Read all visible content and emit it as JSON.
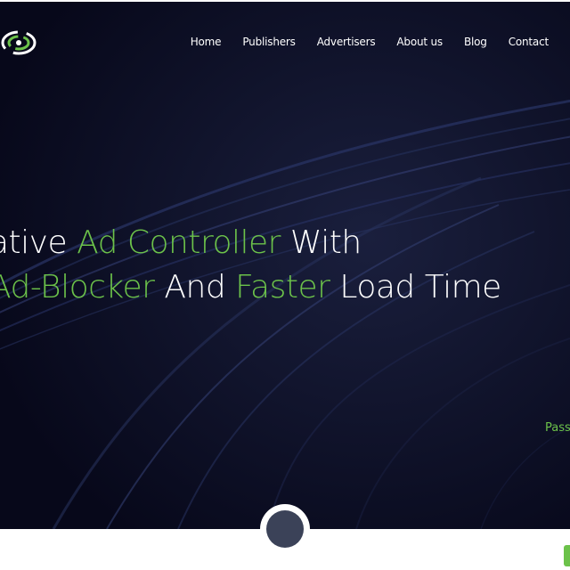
{
  "nav": {
    "items": [
      {
        "label": "Home"
      },
      {
        "label": "Publishers"
      },
      {
        "label": "Advertisers"
      },
      {
        "label": "About us"
      },
      {
        "label": "Blog"
      },
      {
        "label": "Contact"
      }
    ]
  },
  "hero": {
    "line1": {
      "part1": "ative ",
      "part2": "Ad Controller",
      "part3": " With"
    },
    "line2": {
      "part1": "Ad-Blocker",
      "part2": " And ",
      "part3": "Faster",
      "part4": " Load Time"
    },
    "side_text": "Passi"
  },
  "colors": {
    "accent": "#6cc24a",
    "background": "#0b0c1f",
    "text": "#ffffff",
    "scroll_button": "#3b4258"
  },
  "icons": {
    "logo": "logo-icon",
    "scroll": "scroll-down-icon"
  }
}
